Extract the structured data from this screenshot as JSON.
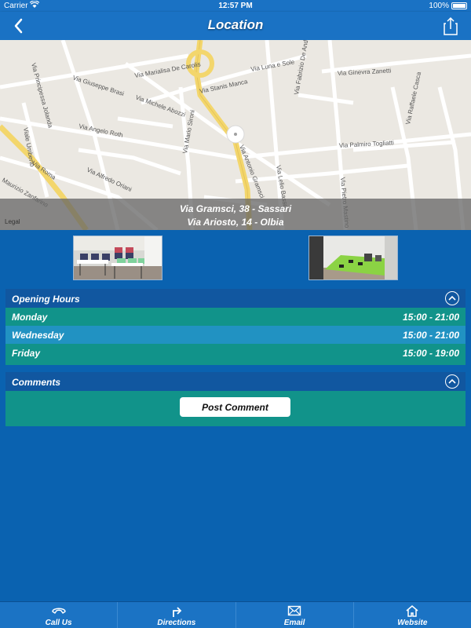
{
  "status_bar": {
    "carrier": "Carrier",
    "time": "12:57 PM",
    "battery": "100%"
  },
  "nav": {
    "title": "Location"
  },
  "map": {
    "legal": "Legal",
    "street_labels": {
      "via_roma": "Via Roma",
      "via_principessa_jolanda": "Via Principessa Jolanda",
      "viale_umberto": "Viale Umberto",
      "via_giuseppe_brasi": "Via Giuseppe Brasi",
      "via_marialisa_de_carolis": "Via Marialisa De Carolis",
      "via_michele_aboz": "Via Michele Abozzi",
      "via_stanis_manca": "Via Stanis Manca",
      "via_luna_e_sole": "Via Luna e Sole",
      "via_fabrizio_de_andre": "Via Fabrizio De Andrè",
      "via_ginevra_zanetti": "Via Ginevra Zanetti",
      "via_raffaele_casca": "Via Raffaele Casca",
      "via_angelo_roth": "Via Angelo Roth",
      "via_mario_sironi": "Via Mario Sironi",
      "via_antonio_gramsci": "Via Antonio Gramsci",
      "via_palmiro_togliatti": "Via Palmiro Togliatti",
      "via_alfredo_oriani": "Via Alfredo Oriani",
      "via_lelio_basso": "Via Lelio Basso",
      "via_pietro_mastino": "Via Pietro Mastino",
      "maurizio_zanfarino": "Maurizio Zanfarino"
    },
    "addresses": [
      "Via Gramsci, 38 - Sassari",
      "Via Ariosto, 14 - Olbia"
    ]
  },
  "opening_hours": {
    "title": "Opening Hours",
    "rows": [
      {
        "day": "Monday",
        "hours": "15:00 - 21:00"
      },
      {
        "day": "Wednesday",
        "hours": "15:00 - 21:00"
      },
      {
        "day": "Friday",
        "hours": "15:00 - 19:00"
      }
    ]
  },
  "comments": {
    "title": "Comments",
    "post_button": "Post Comment"
  },
  "tab_bar": {
    "tabs": [
      {
        "label": "Call Us",
        "icon": "phone-icon"
      },
      {
        "label": "Directions",
        "icon": "directions-icon"
      },
      {
        "label": "Email",
        "icon": "email-icon"
      },
      {
        "label": "Website",
        "icon": "home-icon"
      }
    ]
  },
  "colors": {
    "background": "#0a62b0",
    "bar": "#1a72c4",
    "header": "#1157a0",
    "teal": "#11938a",
    "light_blue_row": "#2192c2"
  }
}
